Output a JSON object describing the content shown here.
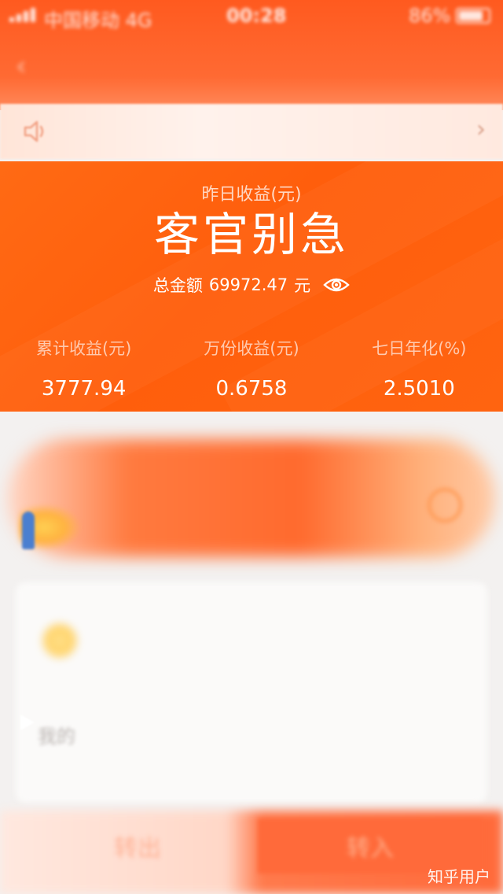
{
  "status_bar": {
    "carrier": "中国移动",
    "network": "4G",
    "time": "00:28",
    "battery": "86%"
  },
  "earnings": {
    "yesterday_label": "昨日收益(元)",
    "yesterday_value": "客官别急",
    "total_label": "总金额",
    "total_amount": "69972.47",
    "total_unit": "元"
  },
  "stats": [
    {
      "label": "累计收益(元)",
      "value": "3777.94"
    },
    {
      "label": "万份收益(元)",
      "value": "0.6758"
    },
    {
      "label": "七日年化(%)",
      "value": "2.5010"
    }
  ],
  "card": {
    "text": "我的"
  },
  "actions": {
    "transfer_out": "转出",
    "transfer_in": "转入"
  },
  "watermark": "知乎用户",
  "icons": {
    "speaker": "speaker-icon",
    "chevron": "chevron-right-icon",
    "eye": "eye-icon",
    "back": "back-icon"
  },
  "colors": {
    "panel": "#ff5e0c",
    "header": "#ff5a1f",
    "text_on_panel": "#ffffff"
  }
}
